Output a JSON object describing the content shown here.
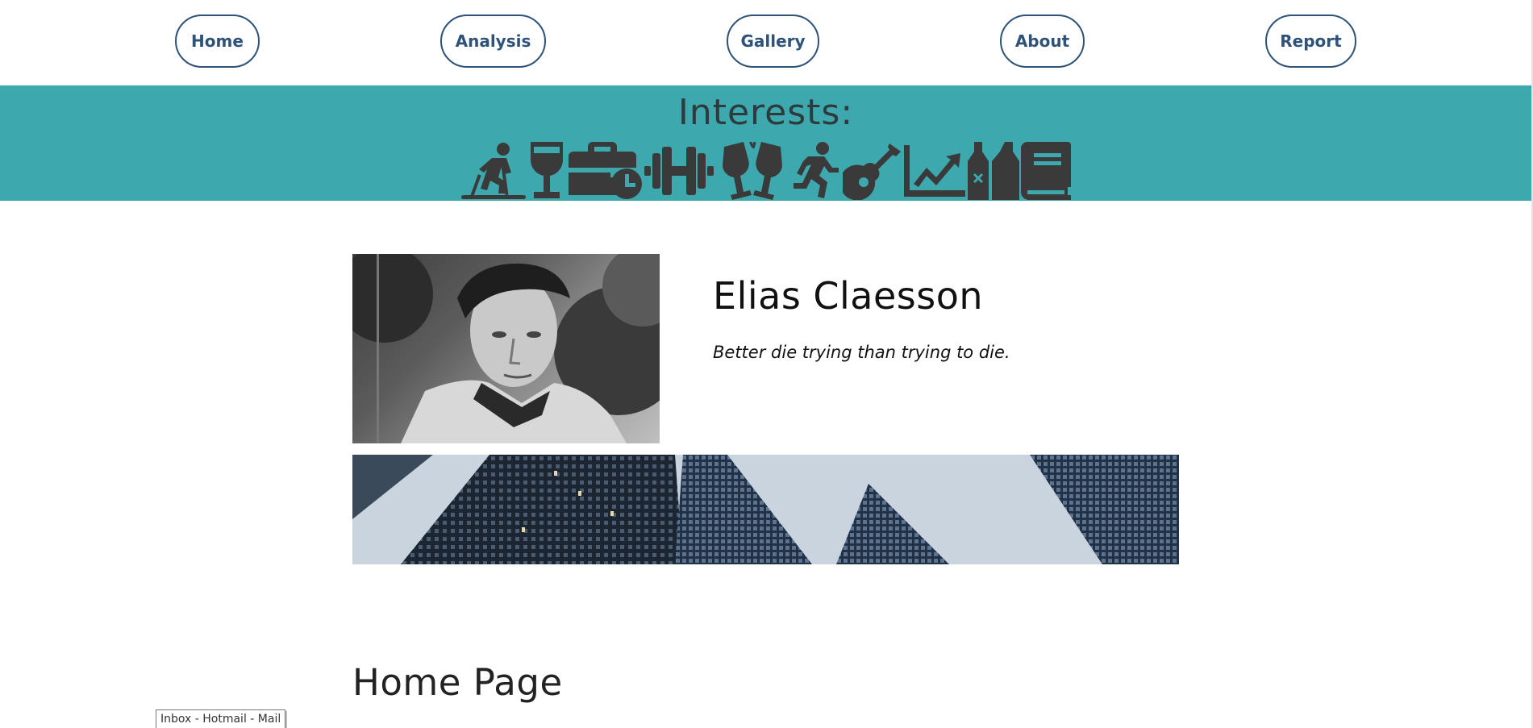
{
  "nav": {
    "items": [
      {
        "label": "Home"
      },
      {
        "label": "Analysis"
      },
      {
        "label": "Gallery"
      },
      {
        "label": "About"
      },
      {
        "label": "Report"
      }
    ]
  },
  "interests": {
    "title": "Interests:",
    "icons": [
      "skiing-icon",
      "wine-glass-icon",
      "business-time-icon",
      "dumbbell-icon",
      "cheers-glasses-icon",
      "running-icon",
      "guitar-icon",
      "chart-line-icon",
      "wine-bottles-icon",
      "book-icon"
    ],
    "icon_color": "#3a3a3a",
    "band_color": "#3da8ad"
  },
  "profile": {
    "name": "Elias Claesson",
    "quote": "Better die trying than trying to die."
  },
  "main": {
    "home_title": "Home Page"
  },
  "status_bar": {
    "tooltip": "Inbox - Hotmail - Mail"
  },
  "colors": {
    "nav_border": "#2f5278",
    "nav_text": "#2f5278"
  }
}
